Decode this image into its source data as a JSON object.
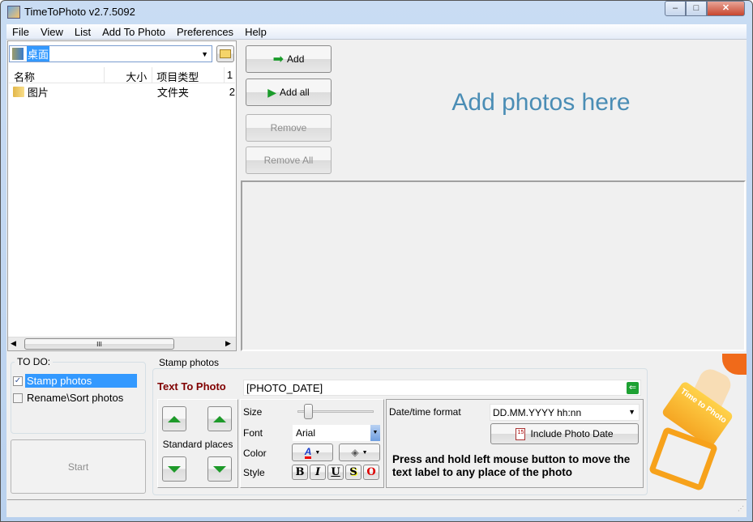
{
  "window": {
    "title": "TimeToPhoto v2.7.5092",
    "min": "–",
    "max": "□",
    "close": "✕"
  },
  "menu": [
    "File",
    "View",
    "List",
    "Add To Photo",
    "Preferences",
    "Help"
  ],
  "browser": {
    "location": "桌面",
    "columns": [
      "名称",
      "大小",
      "项目类型",
      "1"
    ],
    "rows": [
      {
        "name": "图片",
        "size": "",
        "type": "文件夹",
        "extra": "2"
      }
    ],
    "scroll_grip": "III"
  },
  "buttons": {
    "add": "Add",
    "add_all": "Add all",
    "remove": "Remove",
    "remove_all": "Remove All"
  },
  "dropzone": {
    "text": "Add photos here",
    "color": "#4a8db5"
  },
  "todo": {
    "label": "TO DO:",
    "items": [
      {
        "label": "Stamp photos",
        "checked": true
      },
      {
        "label": "Rename\\Sort photos",
        "checked": false
      }
    ],
    "start": "Start"
  },
  "stamp": {
    "label": "Stamp photos",
    "text_label": "Text To Photo",
    "text_value": "[PHOTO_DATE]",
    "standard_places": "Standard places",
    "size_label": "Size",
    "size_value": 0.1,
    "font_label": "Font",
    "font_value": "Arial",
    "color_label": "Color",
    "style_label": "Style",
    "styles": [
      "B",
      "I",
      "U",
      "S",
      "O"
    ],
    "datetime_label": "Date/time format",
    "datetime_value": "DD.MM.YYYY hh:nn",
    "include_date": "Include Photo Date",
    "calendar_day": "15",
    "hint": "Press and hold left mouse button to move the text label to any place of the photo"
  },
  "logo": {
    "text": "Time to Photo"
  }
}
